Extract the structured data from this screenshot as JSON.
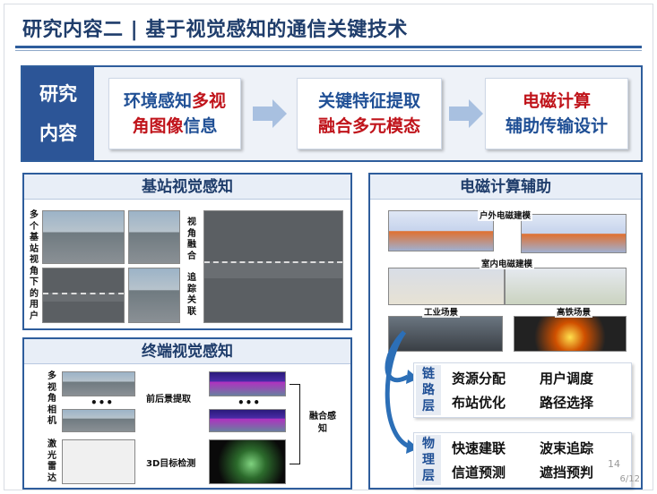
{
  "header": {
    "title": "研究内容二 | 基于视觉感知的通信关键技术"
  },
  "research": {
    "label_line1": "研究",
    "label_line2": "内容",
    "step1": {
      "line1_a": "环境感知",
      "line1_b": "多视",
      "line2_a": "角图像",
      "line2_b": "信息"
    },
    "step2": {
      "line1": "关键特征提取",
      "line2_a": "融合",
      "line2_b": "多元模态"
    },
    "step3": {
      "line1": "电磁计算",
      "line2": "辅助传输设计"
    }
  },
  "panel_bs": {
    "title": "基站视觉感知",
    "left_label": "多个基站视角下的用户",
    "mid_label": "视角融合",
    "mid_label2": "追踪关联"
  },
  "panel_terminal": {
    "title": "终端视觉感知",
    "camera_label": "多视角相机",
    "lidar_label": "激光雷达",
    "dots": "•••",
    "fg_bg": "前后景提取",
    "det3d": "3D目标检测",
    "fusion": "融合感知"
  },
  "panel_em": {
    "title": "电磁计算辅助",
    "outdoor": "户外电磁建模",
    "indoor": "室内电磁建模",
    "industrial": "工业场景",
    "highspeed": "高铁场景",
    "link_layer": {
      "tag_1": "链",
      "tag_2": "路",
      "tag_3": "层",
      "items": [
        "资源分配",
        "用户调度",
        "布站优化",
        "路径选择"
      ]
    },
    "phy_layer": {
      "tag_1": "物",
      "tag_2": "理",
      "tag_3": "层",
      "items": [
        "快速建联",
        "波束追踪",
        "信道预测",
        "遮挡预判"
      ]
    }
  },
  "page": {
    "number": "14",
    "count": "6/12"
  },
  "colors": {
    "brand": "#2e5d9c",
    "accent_red": "#c0141b",
    "title_blue": "#1f3d6b"
  }
}
